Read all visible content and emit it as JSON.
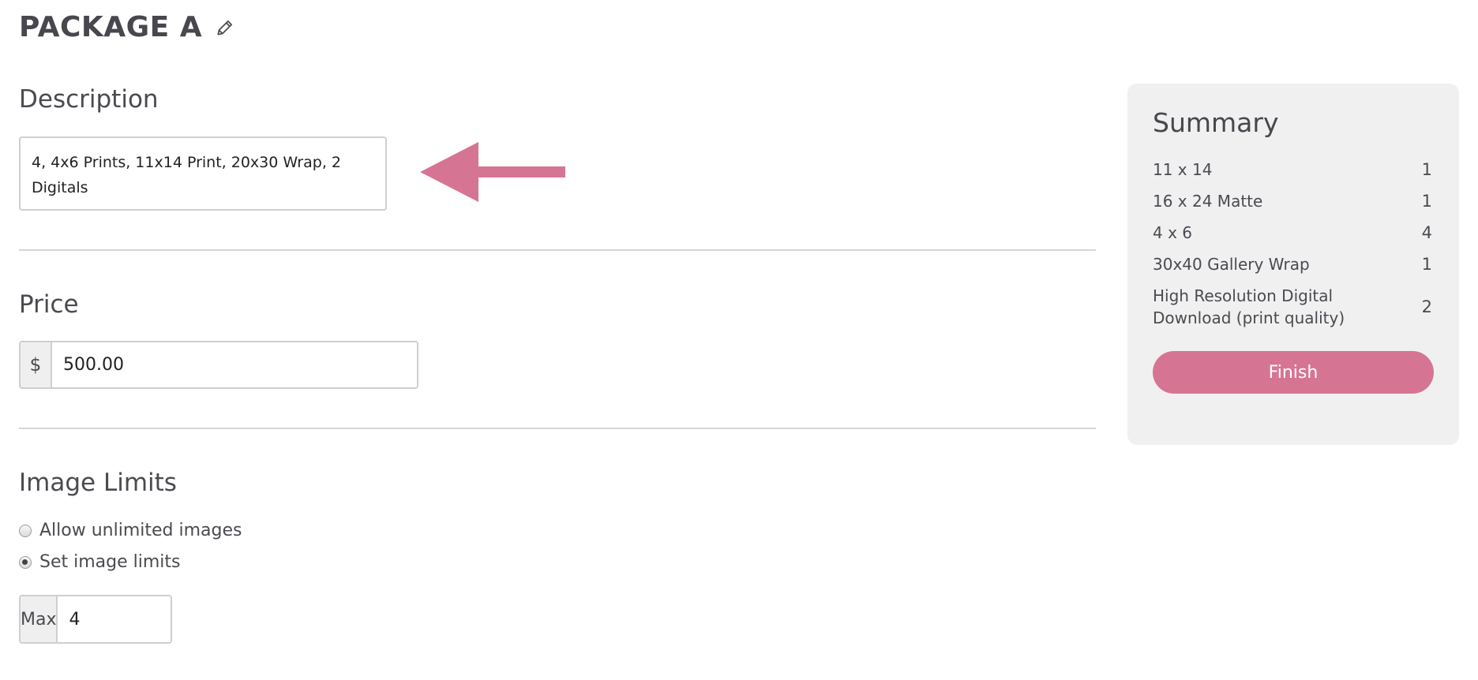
{
  "header": {
    "title": "PACKAGE A",
    "edit_icon": "pencil-icon"
  },
  "description": {
    "heading": "Description",
    "value": "4, 4x6 Prints, 11x14 Print, 20x30 Wrap, 2 Digitals",
    "annotation_icon": "arrow-left-icon",
    "annotation_color": "#d67593"
  },
  "price": {
    "heading": "Price",
    "currency_symbol": "$",
    "value": "500.00"
  },
  "image_limits": {
    "heading": "Image Limits",
    "options": [
      {
        "label": "Allow unlimited images",
        "checked": false
      },
      {
        "label": "Set image limits",
        "checked": true
      }
    ],
    "max_label": "Max",
    "max_value": "4"
  },
  "summary": {
    "title": "Summary",
    "items": [
      {
        "name": "11 x 14",
        "qty": "1"
      },
      {
        "name": "16 x 24 Matte",
        "qty": "1"
      },
      {
        "name": "4 x 6",
        "qty": "4"
      },
      {
        "name": "30x40 Gallery Wrap",
        "qty": "1"
      },
      {
        "name": "High Resolution Digital Download (print quality)",
        "qty": "2"
      }
    ],
    "finish_label": "Finish",
    "accent_color": "#d67593"
  }
}
